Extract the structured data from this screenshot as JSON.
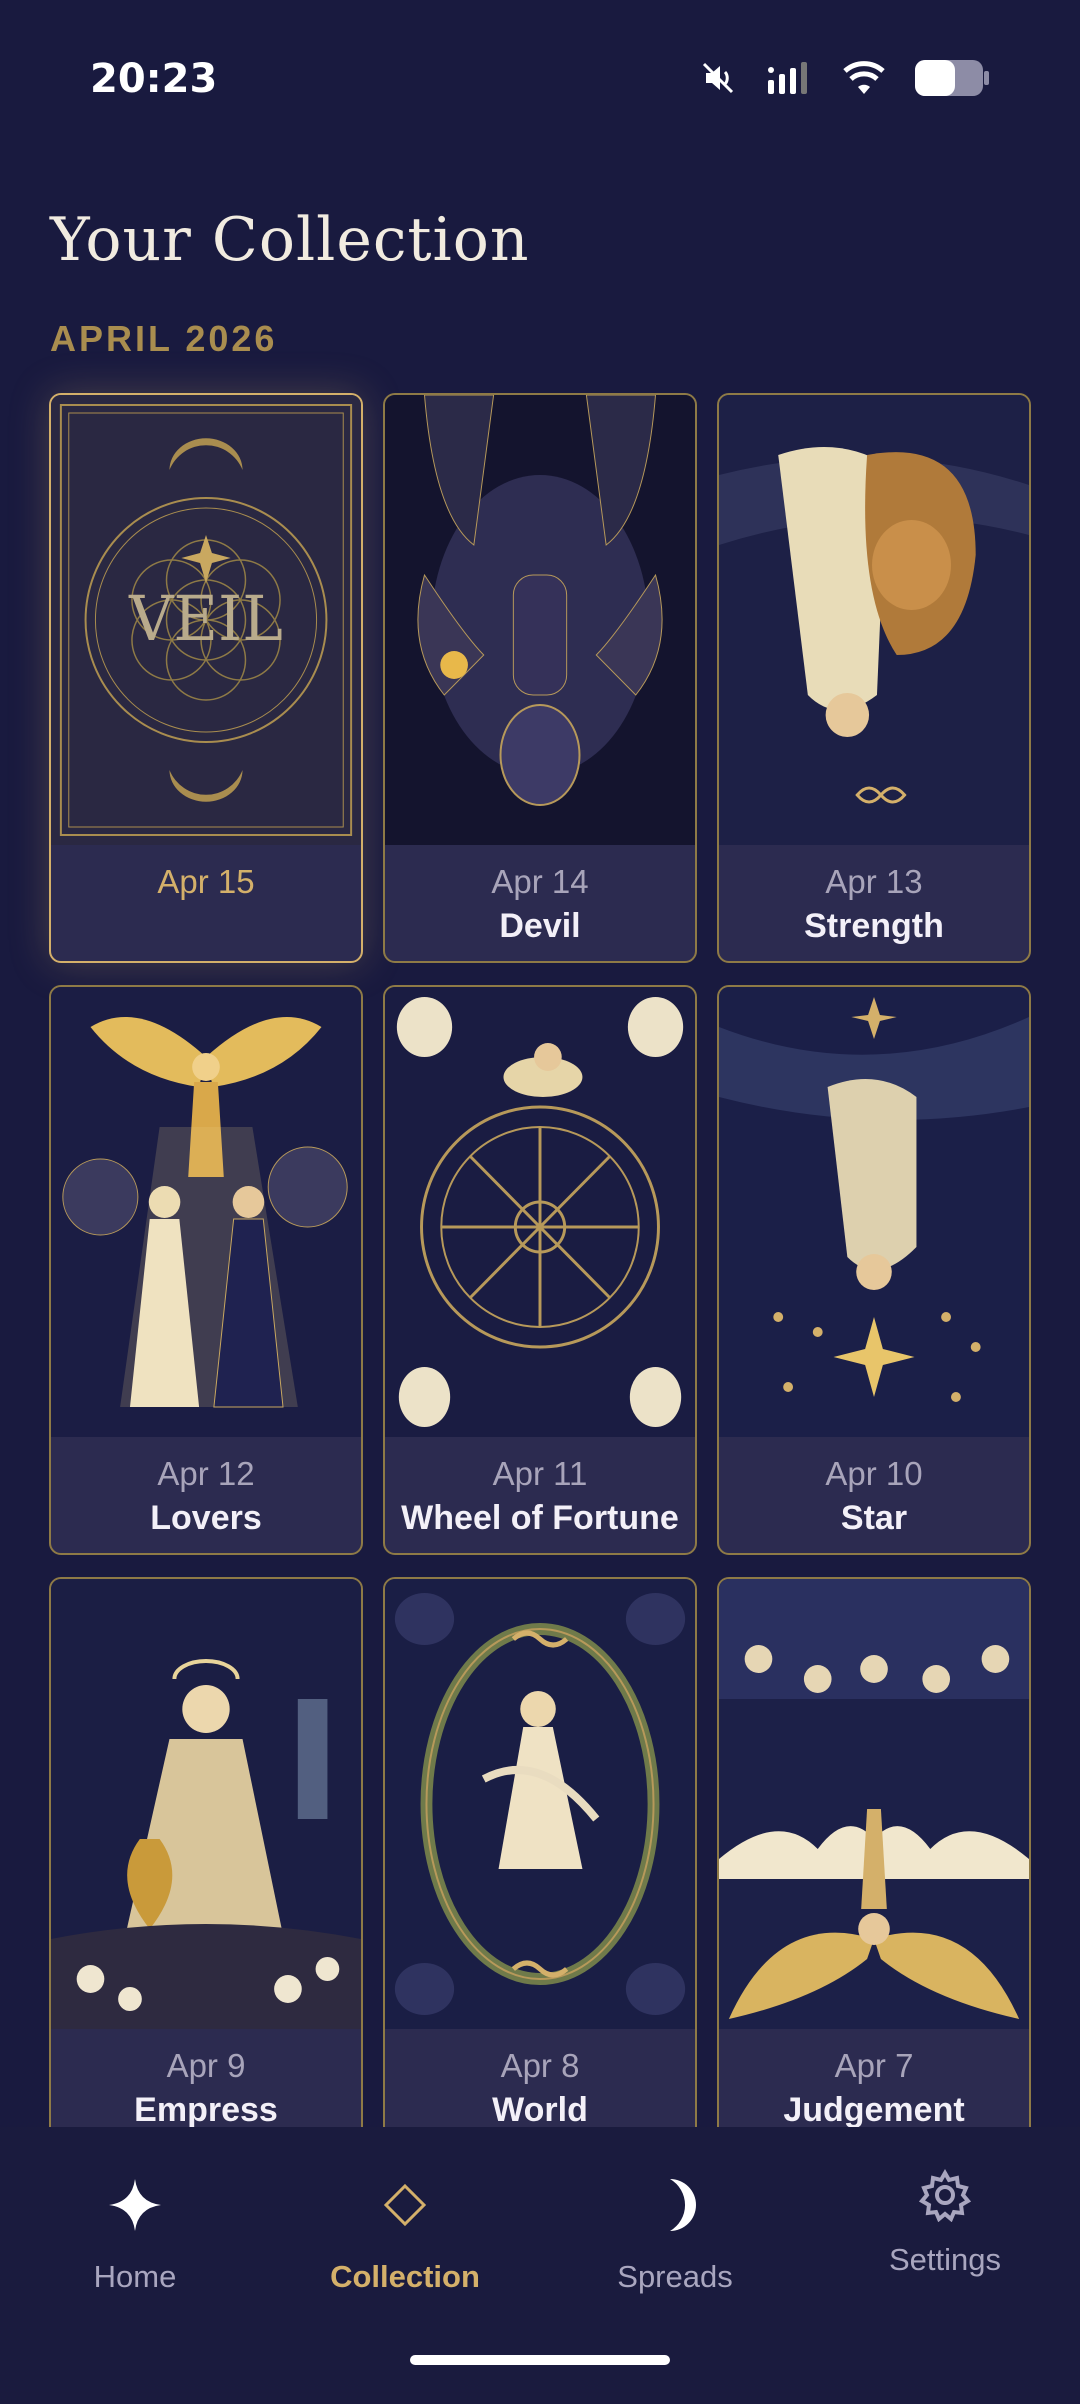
{
  "status_bar": {
    "time": "20:23",
    "icons": [
      "mute-icon",
      "signal-icon",
      "wifi-icon",
      "battery-icon"
    ]
  },
  "page_title": "Your Collection",
  "section_label": "APRIL 2026",
  "colors": {
    "background": "#191a3f",
    "accent_gold": "#d4b06a",
    "card_footer": "#2c2b50",
    "card_border": "#8e7a46"
  },
  "cards": [
    {
      "date": "Apr 15",
      "name": "",
      "art": "veil-card-back",
      "selected": true
    },
    {
      "date": "Apr 14",
      "name": "Devil",
      "art": "devil-card-art"
    },
    {
      "date": "Apr 13",
      "name": "Strength",
      "art": "strength-card-art"
    },
    {
      "date": "Apr 12",
      "name": "Lovers",
      "art": "lovers-card-art"
    },
    {
      "date": "Apr 11",
      "name": "Wheel of Fortune",
      "art": "wheel-card-art"
    },
    {
      "date": "Apr 10",
      "name": "Star",
      "art": "star-card-art"
    },
    {
      "date": "Apr 9",
      "name": "Empress",
      "art": "empress-card-art"
    },
    {
      "date": "Apr 8",
      "name": "World",
      "art": "world-card-art"
    },
    {
      "date": "Apr 7",
      "name": "Judgement",
      "art": "judgement-card-art"
    }
  ],
  "veil_text": "VEIL",
  "nav": {
    "items": [
      {
        "label": "Home",
        "icon": "sparkle-icon"
      },
      {
        "label": "Collection",
        "icon": "diamond-icon",
        "active": true
      },
      {
        "label": "Spreads",
        "icon": "moon-icon"
      },
      {
        "label": "Settings",
        "icon": "gear-icon"
      }
    ]
  }
}
